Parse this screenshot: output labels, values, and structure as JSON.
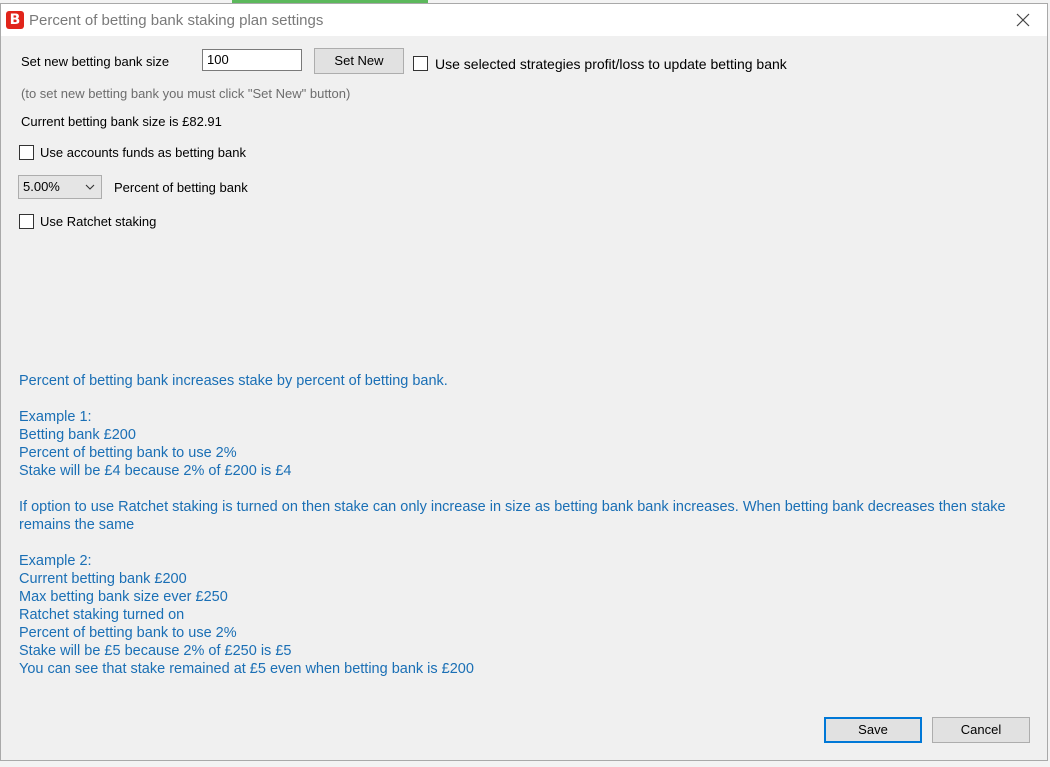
{
  "window": {
    "title": "Percent of betting bank staking plan settings",
    "icon_letter": "B",
    "accent_color": "#e1251b"
  },
  "bank": {
    "set_label": "Set new betting bank size",
    "input_value": "100",
    "set_button_label": "Set New",
    "use_strategies_label": "Use selected strategies profit/loss to update betting bank",
    "hint": "(to set new betting bank you must click \"Set New\" button)",
    "current_label": "Current betting bank size is £82.91",
    "use_accounts_label": "Use accounts funds as betting bank"
  },
  "percent": {
    "selected": "5.00%",
    "label": "Percent of betting bank"
  },
  "ratchet": {
    "label": "Use Ratchet staking"
  },
  "description": {
    "color": "#1a6fb5",
    "intro": "Percent of betting bank increases stake by percent of betting bank.",
    "ex1_title": "Example 1:",
    "ex1_line1": "Betting bank £200",
    "ex1_line2": "Percent of betting bank to use 2%",
    "ex1_line3": "Stake will be £4 because 2% of £200 is £4",
    "ratchet_line1": "If option to use Ratchet staking is turned on then stake can only increase in size as betting bank bank increases. When betting bank decreases then stake",
    "ratchet_line2": "remains the same",
    "ex2_title": "Example 2:",
    "ex2_line1": "Current betting bank £200",
    "ex2_line2": "Max betting bank size ever £250",
    "ex2_line3": "Ratchet staking turned on",
    "ex2_line4": "Percent of betting bank to use 2%",
    "ex2_line5": "Stake will be £5 because 2% of £250 is £5",
    "ex2_line6": "You can see that stake remained at £5 even when betting bank is £200"
  },
  "footer": {
    "save_label": "Save",
    "cancel_label": "Cancel",
    "focus_color": "#0078d7"
  },
  "icons": {
    "app": "app-logo-icon",
    "close": "close-icon",
    "dropdown": "chevron-down-icon"
  }
}
